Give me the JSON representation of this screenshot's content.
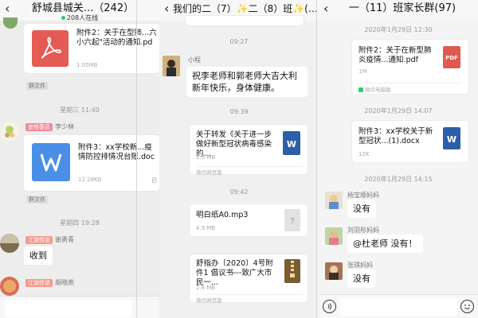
{
  "panel1": {
    "title": "舒城县城关...（242）",
    "online": "208人在线",
    "card1": {
      "name": "附件2：关于在型肺...六小六起\"活动的通知.pd",
      "size": "1.05MB"
    },
    "badge1": "群文件",
    "time1": "星期三 11:40",
    "user1": {
      "tag": "宣传委员",
      "name": "李少林"
    },
    "card2": {
      "name": "附件3：xx学校新...疫情防控排情况台账.doc",
      "size": "12.28KB",
      "status": "已"
    },
    "badge2": "群文件",
    "time2": "星期四 19:28",
    "user2": {
      "tag": "江湖传说",
      "name": "谢勇青",
      "text": "收到"
    },
    "user3": {
      "tag": "江湖传说",
      "name": "胡晓燕"
    }
  },
  "panel2": {
    "title": "我们的二（7）✨二（8）班✨(235)",
    "time0": "09:27",
    "msg1": {
      "name": "小程",
      "text": "祝李老师和郭老师大吉大利新年快乐，身体健康。"
    },
    "time1": "09:39",
    "card1": {
      "name": "关于转发《关于进一步做好新型冠状病毒感染的...",
      "size": "2.5 MB",
      "src": "微信网页版"
    },
    "time2": "09:42",
    "card2": {
      "name": "明白纸A0.mp3",
      "size": "4.9 MB"
    },
    "card3": {
      "name": "舒指办〔2020〕4号附件1 倡议书---致广大市民一...",
      "size": "2.8 MB",
      "src": "微信网页版"
    }
  },
  "panel3": {
    "title": "一（11）班家长群(97)",
    "time1": "2020年1月29日 12:30",
    "card1": {
      "name": "附件2：关于在新型肺炎疫情...通知.pdf",
      "size": "1M",
      "src": "微信电脑版"
    },
    "time2": "2020年1月29日 14:07",
    "card2": {
      "name": "附件3：xx学校关于新型冠状...(1).docx",
      "size": "12K"
    },
    "time3": "2020年1月29日 14:15",
    "m1": {
      "name": "杨宝顺妈妈",
      "text": "没有"
    },
    "m2": {
      "name": "刘羽彤妈妈",
      "text": "@杜老师 没有！"
    },
    "m3": {
      "name": "张琪妈妈",
      "text": "没有"
    }
  },
  "icons": {
    "pdf": "PDF",
    "word": "W",
    "unknown": "?"
  }
}
